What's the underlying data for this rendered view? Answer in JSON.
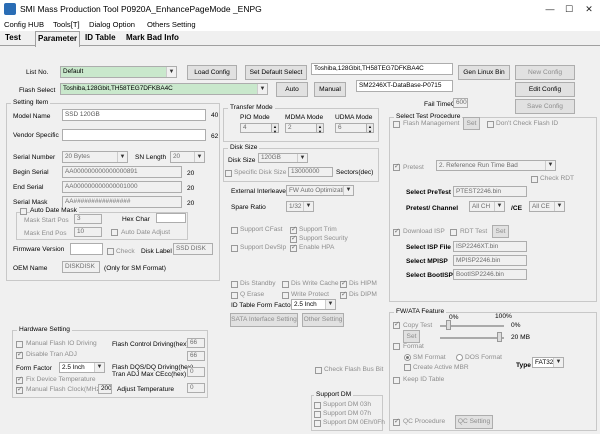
{
  "window": {
    "title": "SMI Mass Production Tool P0920A_EnhancePageMode    _ENPG"
  },
  "menu": [
    "Config HUB",
    "Tools[T]",
    "Dialog Option",
    "Others Setting"
  ],
  "tabs": [
    "Test",
    "Parameter",
    "ID Table",
    "Mark Bad Info"
  ],
  "top": {
    "list_no_label": "List No.",
    "list_no_value": "Default",
    "load_config": "Load Config",
    "set_default_select": "Set Default Select",
    "flash_info": "Toshiba,128Gbit,TH58TEG7DFKBA4C",
    "gen_linux_bin": "Gen Linux Bin",
    "new_config": "New Config",
    "flash_select_label": "Flash Select",
    "flash_select_value": "Toshiba,128Gbit,TH58TEG7DFKBA4C",
    "auto": "Auto",
    "manual": "Manual",
    "database": "SM2246XT-DataBase-P0715",
    "edit_config": "Edit Config",
    "fail_timeout_label": "Fail TimeOut",
    "fail_timeout_value": "600",
    "save_config": "Save Config"
  },
  "setting_item": {
    "title": "Setting Item",
    "model_name_label": "Model Name",
    "model_name_value": "SSD 120GB",
    "model_name_len": "40",
    "vendor_specific_label": "Vendor Specific",
    "vendor_specific_len": "62",
    "serial_number_label": "Serial Number",
    "serial_number_value": "20 Bytes",
    "sn_length_label": "SN Length",
    "sn_length_value": "20",
    "begin_serial_label": "Begin Serial",
    "begin_serial_value": "AA000000000000000891",
    "begin_serial_len": "20",
    "end_serial_label": "End Serial",
    "end_serial_value": "AA000000000000001000",
    "end_serial_len": "20",
    "serial_mask_label": "Serial Mask",
    "serial_mask_value": "AA################",
    "serial_mask_len": "20",
    "auto_date_mask": "Auto Date Mask",
    "mask_start_pos_label": "Mask Start Pos",
    "mask_start_pos_value": "3",
    "hex_char_label": "Hex Char",
    "mask_end_pos_label": "Mask End Pos",
    "mask_end_pos_value": "10",
    "auto_date_adjust": "Auto Date Adjust",
    "firmware_version_label": "Firmware Version",
    "check_label": "Check",
    "disk_label_label": "Disk Label",
    "disk_label_value": "SSD DISK",
    "oem_name_label": "OEM Name",
    "oem_name_value": "DISKDISK",
    "oem_name_note": "(Only for SM Format)"
  },
  "transfer_mode": {
    "title": "Transfer Mode",
    "pio_label": "PIO Mode",
    "pio_value": "4",
    "mdma_label": "MDMA Mode",
    "mdma_value": "2",
    "udma_label": "UDMA Mode",
    "udma_value": "6"
  },
  "disk_size": {
    "title": "Disk Size",
    "disk_size_label": "Disk Size",
    "disk_size_value": "120GB",
    "specific_disk_size_label": "Specific Disk Size",
    "specific_disk_size_value": "13000000",
    "sectors_label": "Sectors(dec)"
  },
  "mid": {
    "external_interleave_label": "External Interleave",
    "external_interleave_value": "FW Auto Optimization",
    "spare_ratio_label": "Spare Ratio",
    "spare_ratio_value": "1/32",
    "support_cfast": "Support CFast",
    "support_trim": "Support Trim",
    "support_security": "Support Security",
    "support_devslp": "Support DevSlp",
    "enable_hpa": "Enable HPA",
    "dis_standby": "Dis Standby",
    "dis_write_cache": "Dis Write Cache",
    "dis_hipm": "Dis HIPM",
    "q_erase": "Q Erase",
    "write_protect": "Write Protect",
    "dis_dipm": "Dis DIPM",
    "id_table_form_factor_label": "ID Table Form Factor",
    "id_table_form_factor_value": "2.5 Inch",
    "sata_interface_setting": "SATA Interface Setting",
    "other_setting": "Other Setting",
    "check_flash_bus_bit": "Check Flash Bus Bit"
  },
  "hardware": {
    "title": "Hardware Setting",
    "manual_flash_io_driving": "Manual Flash IO Driving",
    "flash_control_driving_label": "Flash Control Driving(hex)",
    "flash_control_driving_value": "66",
    "disable_tran_adj": "Disable Tran ADJ",
    "flash_dqs_label": "Flash DQS/DQ Driving(hex)",
    "flash_dqs_value": "66",
    "form_factor_label": "Form Factor",
    "form_factor_value": "2.5 Inch",
    "tran_adj_label": "Tran ADJ Max CEcc(hex)",
    "tran_adj_value": "0",
    "fix_device_temperature": "Fix Device Temperature",
    "manual_flash_clock": "Manual Flash Clock(MHz)",
    "manual_flash_clock_value": "200",
    "adjust_temperature_label": "Adjust Temperature",
    "adjust_temperature_value": "0"
  },
  "support_dm": {
    "title": "Support DM",
    "dm03h": "Support DM 03h",
    "dm07h": "Support DM 07h",
    "dm0e": "Support DM 0Eh/0Fh"
  },
  "select_test": {
    "title": "Select Test Procedure",
    "flash_management": "Flash Management",
    "set": "Set",
    "dont_check_flash_id": "Don't Check Flash ID",
    "pretest": "Pretest",
    "pretest_value": "2. Reference Run Time Bad",
    "check_rdt": "Check RDT",
    "select_pretest_label": "Select PreTest",
    "select_pretest_value": "PTEST2246.bin",
    "pretest_channel_label": "Pretest/ Channel",
    "pretest_channel_value": "All CH",
    "ce_label": "/CE",
    "ce_value": "All CE",
    "download_isp": "Download ISP",
    "rdt_test": "RDT Test",
    "select_isp_file_label": "Select ISP File",
    "select_isp_file_value": "ISP2246XT.bin",
    "select_mpisp_label": "Select MPISP",
    "select_mpisp_value": "MPISP2246.bin",
    "select_bootisp_label": "Select BootISP",
    "select_bootisp_value": "BootISP2246.bin"
  },
  "fw_ata": {
    "title": "FW/ATA Feature",
    "copy_test": "Copy Test",
    "pct_0_a": "0%",
    "pct_100": "100%",
    "pct_0_b": "0%",
    "set": "Set",
    "mb_20": "20 MB",
    "format": "Format",
    "sm_format": "SM Format",
    "dos_format": "DOS Format",
    "create_active_mbr": "Create Active MBR",
    "type_label": "Type",
    "type_value": "FAT32",
    "keep_id_table": "Keep ID Table",
    "qc_procedure": "QC Procedure",
    "qc_setting": "QC Setting"
  }
}
